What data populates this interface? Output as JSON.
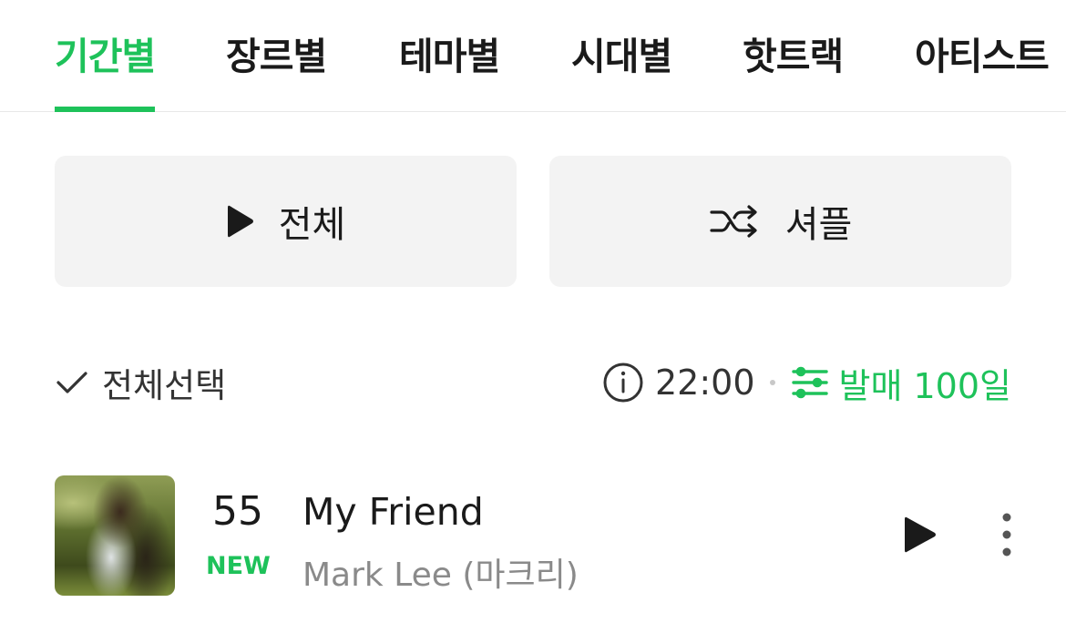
{
  "tabs": [
    {
      "label": "기간별",
      "active": true
    },
    {
      "label": "장르별"
    },
    {
      "label": "테마별"
    },
    {
      "label": "시대별"
    },
    {
      "label": "핫트랙"
    },
    {
      "label": "아티스트"
    }
  ],
  "actions": {
    "play_all_label": "전체",
    "shuffle_label": "셔플"
  },
  "toolbar": {
    "select_all_label": "전체선택",
    "time": "22:00",
    "filter_label": "발매 100일"
  },
  "track": {
    "rank": "55",
    "badge": "NEW",
    "title": "My Friend",
    "artist": "Mark Lee (마크리)"
  },
  "colors": {
    "accent": "#1ec25a",
    "button_bg": "#f3f3f3",
    "text": "#1a1a1a",
    "muted": "#8a8a8a"
  },
  "icons": [
    "play-icon",
    "shuffle-icon",
    "check-icon",
    "info-icon",
    "filter-icon",
    "more-icon"
  ]
}
